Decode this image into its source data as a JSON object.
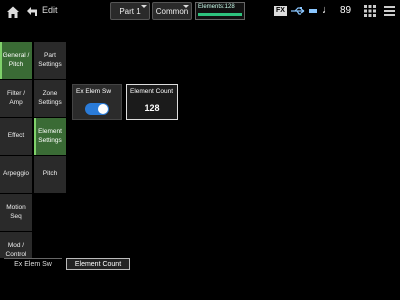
{
  "header": {
    "edit_label": "Edit",
    "part_tab": "Part 1",
    "common_tab": "Common",
    "elements_label": "Elements:128",
    "elements_fill_fraction": 1.0,
    "fx_label": "FX",
    "tempo": "89",
    "note_glyph": "♩"
  },
  "nav": {
    "col1": [
      {
        "label": "General / Pitch",
        "active": true
      },
      {
        "label": "Filter / Amp",
        "active": false
      },
      {
        "label": "Effect",
        "active": false
      },
      {
        "label": "Arpeggio",
        "active": false
      },
      {
        "label": "Motion Seq",
        "active": false
      },
      {
        "label": "Mod / Control",
        "active": false
      }
    ],
    "col2": [
      {
        "label": "Part Settings",
        "active": false
      },
      {
        "label": "Zone Settings",
        "active": false
      },
      {
        "label": "Element Settings",
        "active": true
      },
      {
        "label": "Pitch",
        "active": false
      }
    ]
  },
  "main": {
    "ex_elem_sw": {
      "label": "Ex Elem Sw",
      "state": "on"
    },
    "element_count": {
      "label": "Element Count",
      "value": "128"
    }
  },
  "bottom": {
    "tab1": "Ex Elem Sw",
    "tab2": "Element Count"
  },
  "colors": {
    "active_nav": "#3a6b35",
    "toggle_on": "#2a7bd8",
    "elements_bar": "#2ec27e"
  }
}
